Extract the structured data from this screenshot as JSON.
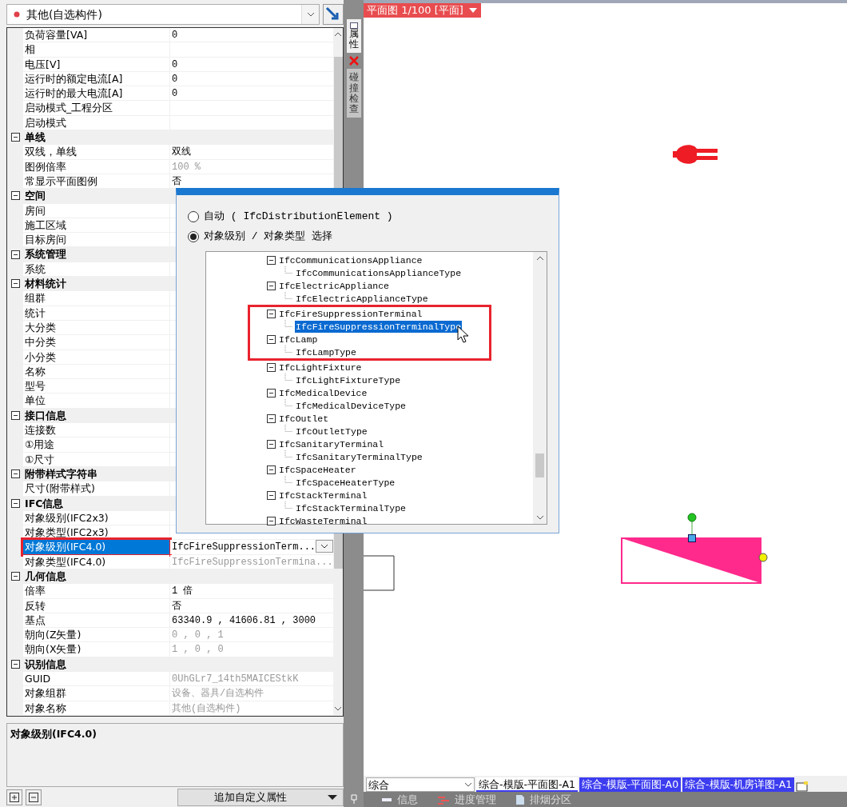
{
  "component_selector": {
    "value": "其他(自选构件)"
  },
  "properties": [
    {
      "kind": "row",
      "label": "负荷容量[VA]",
      "value": "0",
      "disabled": false,
      "selected": false,
      "highlighted": false
    },
    {
      "kind": "row",
      "label": "相",
      "selected": false,
      "highlighted": false
    },
    {
      "kind": "row",
      "label": "电压[V]",
      "value": "0",
      "disabled": false,
      "selected": false,
      "highlighted": false
    },
    {
      "kind": "row",
      "label": "运行时的额定电流[A]",
      "value": "0",
      "disabled": false,
      "selected": false,
      "highlighted": false
    },
    {
      "kind": "row",
      "label": "运行时的最大电流[A]",
      "value": "0",
      "disabled": false,
      "selected": false,
      "highlighted": false
    },
    {
      "kind": "row",
      "label": "启动模式_工程分区",
      "selected": false,
      "highlighted": false
    },
    {
      "kind": "row",
      "label": "启动模式",
      "selected": false,
      "highlighted": false
    },
    {
      "kind": "group",
      "label": "单线",
      "expanded": true
    },
    {
      "kind": "row",
      "label": "双线，单线",
      "value": "双线",
      "disabled": false,
      "selected": false,
      "highlighted": false
    },
    {
      "kind": "row",
      "label": "图例倍率",
      "value": "100 %",
      "disabled": true,
      "selected": false,
      "highlighted": false
    },
    {
      "kind": "row",
      "label": "常显示平面图例",
      "value": "否",
      "disabled": false,
      "selected": false,
      "highlighted": false
    },
    {
      "kind": "group",
      "label": "空间",
      "expanded": true
    },
    {
      "kind": "row",
      "label": "房间",
      "selected": false,
      "highlighted": false
    },
    {
      "kind": "row",
      "label": "施工区域",
      "selected": false,
      "highlighted": false
    },
    {
      "kind": "row",
      "label": "目标房间",
      "selected": false,
      "highlighted": false
    },
    {
      "kind": "group",
      "label": "系统管理",
      "expanded": true
    },
    {
      "kind": "row",
      "label": "系统",
      "selected": false,
      "highlighted": false
    },
    {
      "kind": "group",
      "label": "材料统计",
      "expanded": true
    },
    {
      "kind": "row",
      "label": "组群",
      "selected": false,
      "highlighted": false
    },
    {
      "kind": "row",
      "label": "统计",
      "selected": false,
      "highlighted": false
    },
    {
      "kind": "row",
      "label": "大分类",
      "selected": false,
      "highlighted": false
    },
    {
      "kind": "row",
      "label": "中分类",
      "selected": false,
      "highlighted": false
    },
    {
      "kind": "row",
      "label": "小分类",
      "selected": false,
      "highlighted": false
    },
    {
      "kind": "row",
      "label": "名称",
      "selected": false,
      "highlighted": false
    },
    {
      "kind": "row",
      "label": "型号",
      "selected": false,
      "highlighted": false
    },
    {
      "kind": "row",
      "label": "单位",
      "selected": false,
      "highlighted": false
    },
    {
      "kind": "group",
      "label": "接口信息",
      "expanded": true
    },
    {
      "kind": "row",
      "label": "连接数",
      "selected": false,
      "highlighted": false
    },
    {
      "kind": "row",
      "label": "①用途",
      "selected": false,
      "highlighted": false
    },
    {
      "kind": "row",
      "label": "①尺寸",
      "selected": false,
      "highlighted": false
    },
    {
      "kind": "group",
      "label": "附带样式字符串",
      "expanded": true
    },
    {
      "kind": "row",
      "label": "尺寸(附带样式)",
      "selected": false,
      "highlighted": false
    },
    {
      "kind": "group",
      "label": "IFC信息",
      "expanded": true
    },
    {
      "kind": "row",
      "label": "对象级别(IFC2x3)",
      "selected": false,
      "highlighted": false
    },
    {
      "kind": "row",
      "label": "对象类型(IFC2x3)",
      "selected": false,
      "highlighted": false
    },
    {
      "kind": "dropdown",
      "label": "对象级别(IFC4.0)",
      "value": "IfcFireSuppressionTerm...",
      "disabled": false,
      "selected": true,
      "highlighted": true
    },
    {
      "kind": "row",
      "label": "对象类型(IFC4.0)",
      "value": "IfcFireSuppressionTermina...",
      "disabled": true,
      "selected": false,
      "highlighted": false
    },
    {
      "kind": "group",
      "label": "几何信息",
      "expanded": true
    },
    {
      "kind": "row",
      "label": "倍率",
      "value": "1 倍",
      "disabled": false,
      "selected": false,
      "highlighted": false
    },
    {
      "kind": "row",
      "label": "反转",
      "value": "否",
      "disabled": false,
      "selected": false,
      "highlighted": false
    },
    {
      "kind": "row",
      "label": "基点",
      "value": "63340.9 , 41606.81 , 3000",
      "disabled": false,
      "selected": false,
      "highlighted": false
    },
    {
      "kind": "row",
      "label": "朝向(Z矢量)",
      "value": "0 , 0 , 1",
      "disabled": true,
      "selected": false,
      "highlighted": false
    },
    {
      "kind": "row",
      "label": "朝向(X矢量)",
      "value": "1 , 0 , 0",
      "disabled": true,
      "selected": false,
      "highlighted": false
    },
    {
      "kind": "group",
      "label": "识别信息",
      "expanded": true
    },
    {
      "kind": "row",
      "label": "GUID",
      "value": "0UhGLr7_14th5MAICEStkK",
      "disabled": true,
      "selected": false,
      "highlighted": false
    },
    {
      "kind": "row",
      "label": "对象组群",
      "value": "设备、器具/自选构件",
      "disabled": true,
      "selected": false,
      "highlighted": false
    },
    {
      "kind": "row",
      "label": "对象名称",
      "value": "其他(自选构件)",
      "disabled": true,
      "selected": false,
      "highlighted": false
    }
  ],
  "description": {
    "title": "对象级别(IFC4.0)"
  },
  "footer": {
    "add_button": "追加自定义属性"
  },
  "side_tabs": [
    {
      "label": "属性",
      "closable": true
    },
    {
      "label": "碰撞检查",
      "closable": false
    }
  ],
  "view_tab": {
    "label": "平面图 1/100 [平面]"
  },
  "dialog": {
    "options": [
      {
        "label": "自动 ( IfcDistributionElement )",
        "selected": false
      },
      {
        "label": "对象级别 / 对象类型 选择",
        "selected": true
      }
    ],
    "tree": [
      {
        "label": "IfcCommunicationsAppliance",
        "selected": false,
        "highlighted": false,
        "expanded": true,
        "children": [
          {
            "label": "IfcCommunicationsApplianceType",
            "selected": false
          }
        ]
      },
      {
        "label": "IfcElectricAppliance",
        "selected": false,
        "highlighted": false,
        "expanded": true,
        "children": [
          {
            "label": "IfcElectricApplianceType",
            "selected": false
          }
        ]
      },
      {
        "label": "IfcFireSuppressionTerminal",
        "selected": false,
        "highlighted": true,
        "expanded": true,
        "children": [
          {
            "label": "IfcFireSuppressionTerminalType",
            "selected": true
          }
        ]
      },
      {
        "label": "IfcLamp",
        "selected": false,
        "highlighted": true,
        "expanded": true,
        "children": [
          {
            "label": "IfcLampType",
            "selected": false
          }
        ]
      },
      {
        "label": "IfcLightFixture",
        "selected": false,
        "highlighted": false,
        "expanded": true,
        "children": [
          {
            "label": "IfcLightFixtureType",
            "selected": false
          }
        ]
      },
      {
        "label": "IfcMedicalDevice",
        "selected": false,
        "highlighted": false,
        "expanded": true,
        "children": [
          {
            "label": "IfcMedicalDeviceType",
            "selected": false
          }
        ]
      },
      {
        "label": "IfcOutlet",
        "selected": false,
        "highlighted": false,
        "expanded": true,
        "children": [
          {
            "label": "IfcOutletType",
            "selected": false
          }
        ]
      },
      {
        "label": "IfcSanitaryTerminal",
        "selected": false,
        "highlighted": false,
        "expanded": true,
        "children": [
          {
            "label": "IfcSanitaryTerminalType",
            "selected": false
          }
        ]
      },
      {
        "label": "IfcSpaceHeater",
        "selected": false,
        "highlighted": false,
        "expanded": true,
        "children": [
          {
            "label": "IfcSpaceHeaterType",
            "selected": false
          }
        ]
      },
      {
        "label": "IfcStackTerminal",
        "selected": false,
        "highlighted": false,
        "expanded": true,
        "children": [
          {
            "label": "IfcStackTerminalType",
            "selected": false
          }
        ]
      },
      {
        "label": "IfcWasteTerminal",
        "selected": false,
        "highlighted": false,
        "expanded": true
      }
    ]
  },
  "drawing_tabs": {
    "filter": "综合",
    "tabs": [
      {
        "label": "综合-模版-平面图-A1",
        "selected": true
      },
      {
        "label": "综合-模版-平面图-A0",
        "selected": false
      },
      {
        "label": "综合-模版-机房详图-A1",
        "selected": false
      }
    ]
  },
  "bottom_tabs": [
    {
      "label": "信息"
    },
    {
      "label": "进度管理"
    },
    {
      "label": "排烟分区"
    }
  ]
}
